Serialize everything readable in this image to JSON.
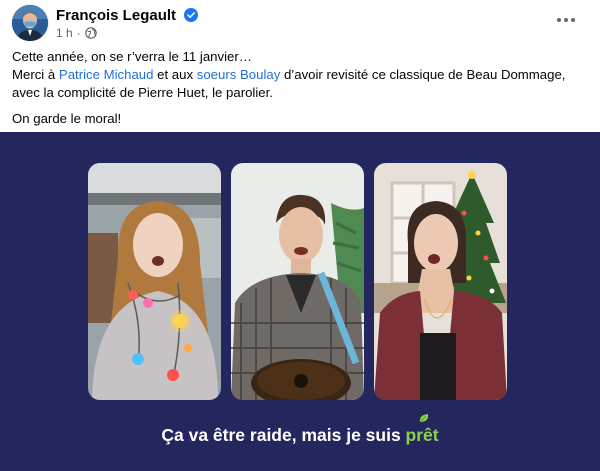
{
  "post": {
    "author": "François Legault",
    "time": "1 h",
    "separator": "·",
    "paragraphs": {
      "line1": "Cette année, on se r’verra le 11 janvier…",
      "line2_pre": "Merci à ",
      "link1": "Patrice Michaud",
      "line2_mid": " et aux ",
      "link2": "soeurs Boulay",
      "line2_post": " d’avoir revisité ce classique de Beau Dommage, avec la complicité de Pierre Huet, le parolier.",
      "line3": "On garde le moral!"
    }
  },
  "video": {
    "lyrics_main": "Ça va être raide, mais je suis ",
    "lyrics_accent": "prêt"
  },
  "icons": {
    "verified": "verified-badge-icon",
    "globe": "globe-icon",
    "more": "more-options-icon",
    "leaf": "leaf-icon"
  },
  "colors": {
    "link": "#216fdb",
    "video_background": "#23275e",
    "lyrics_accent": "#8fd14f",
    "verified": "#1877f2",
    "muted_text": "#65676b"
  }
}
